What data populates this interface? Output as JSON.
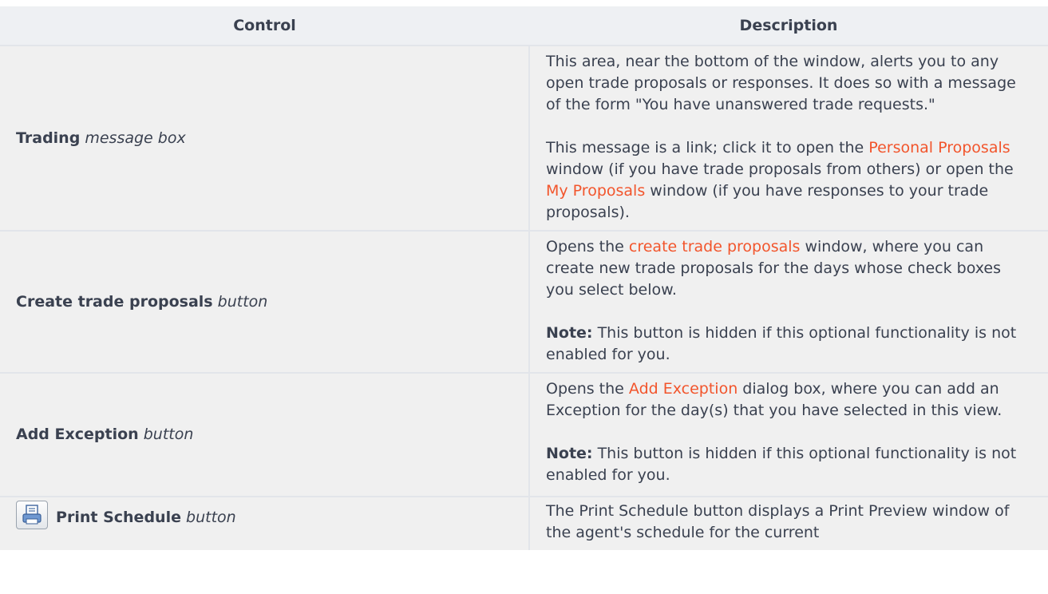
{
  "table": {
    "headers": [
      "Control",
      "Description"
    ],
    "rows": [
      {
        "control_bold": "Trading",
        "control_italic": "message box",
        "desc": {
          "p1": "This area, near the bottom of the window, alerts you to any open trade proposals or responses. It does so with a message of the form \"You have unanswered trade requests.\"",
          "p2_a": "This message is a link; click it to open the ",
          "p2_link1": "Personal Proposals",
          "p2_b": " window (if you have trade proposals from others) or open the ",
          "p2_link2": "My Proposals",
          "p2_c": " window (if you have responses to your trade proposals)."
        }
      },
      {
        "control_bold": "Create trade proposals",
        "control_italic": "button",
        "desc": {
          "p1_a": "Opens the ",
          "p1_link": "create trade proposals",
          "p1_b": " window, where you can create new trade proposals for the days whose check boxes you select below.",
          "note_label": "Note:",
          "note_text": " This button is hidden if this optional functionality is not enabled for you."
        }
      },
      {
        "control_bold": "Add Exception",
        "control_italic": "button",
        "desc": {
          "p1_a": "Opens the ",
          "p1_link": "Add Exception",
          "p1_b": " dialog box, where you can add an Exception for the day(s) that you have selected in this view.",
          "note_label": "Note:",
          "note_text": " This button is hidden if this optional functionality is not enabled for you."
        }
      },
      {
        "icon": "print-icon",
        "control_bold": "Print Schedule",
        "control_italic": "button",
        "desc": {
          "p1": "The Print Schedule button displays a Print Preview window of the agent's schedule for the current"
        }
      }
    ]
  },
  "colors": {
    "link": "#f2552c",
    "header_bg": "#eef0f3",
    "row_bg": "#f0f0f0",
    "text": "#3a4150"
  }
}
